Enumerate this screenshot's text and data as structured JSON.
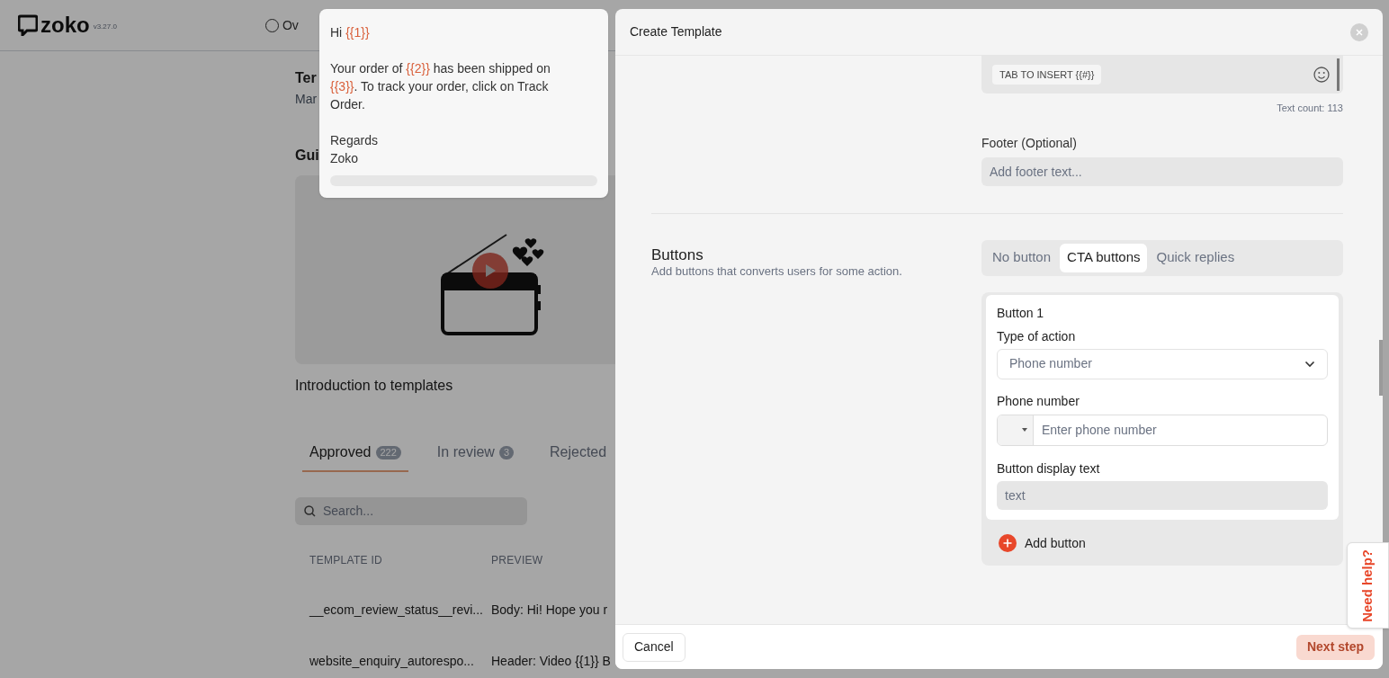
{
  "app": {
    "logo": "zoko",
    "version": "v3.27.0",
    "nav": [
      {
        "label": "Ov"
      }
    ]
  },
  "page": {
    "title": "Ter",
    "subtitle": "Mar",
    "guide_heading": "Gui",
    "video": {
      "caption": "Introduction to templates"
    },
    "tabs": [
      {
        "label": "Approved",
        "count": "222",
        "selected": true
      },
      {
        "label": "In review",
        "count": "3",
        "selected": false
      },
      {
        "label": "Rejected",
        "selected": false
      }
    ],
    "search": {
      "placeholder": "Search..."
    },
    "table": {
      "columns": [
        "TEMPLATE ID",
        "PREVIEW"
      ],
      "rows": [
        [
          "__ecom_review_status__revi...",
          "Body: Hi! Hope you r"
        ],
        [
          "website_enquiry_autorespo...",
          "Header: Video {{1}} B"
        ]
      ]
    }
  },
  "preview_popup": {
    "blocks": [
      {
        "lines": [
          [
            {
              "kind": "text",
              "text": "Hi "
            },
            {
              "kind": "variable",
              "text": "{{1}}"
            }
          ]
        ]
      },
      {
        "lines": [
          [
            {
              "kind": "text",
              "text": "Your order of "
            },
            {
              "kind": "variable",
              "text": "{{2}}"
            },
            {
              "kind": "text",
              "text": " has been shipped on "
            },
            {
              "kind": "variable",
              "text": "{{3}}"
            },
            {
              "kind": "text",
              "text": ". To track your order, click on Track Order."
            }
          ]
        ]
      },
      {
        "lines": [
          [
            {
              "kind": "text",
              "text": "Regards"
            }
          ],
          [
            {
              "kind": "text",
              "text": "Zoko"
            }
          ]
        ]
      }
    ]
  },
  "modal": {
    "title": "Create Template",
    "body_field": {
      "chip": "TAB TO INSERT {{#}}",
      "text_count": "Text count: 113"
    },
    "footer_field": {
      "label": "Footer (Optional)",
      "placeholder": "Add footer text..."
    },
    "buttons_section": {
      "title": "Buttons",
      "description": "Add buttons that converts users for some action.",
      "options": [
        {
          "label": "No button",
          "selected": false
        },
        {
          "label": "CTA buttons",
          "selected": true
        },
        {
          "label": "Quick replies",
          "selected": false
        }
      ],
      "button_cards": [
        {
          "title": "Button 1",
          "action_label": "Type of action",
          "action_value": "Phone number",
          "phone_label": "Phone number",
          "phone_placeholder": "Enter phone number",
          "display_label": "Button display text",
          "display_placeholder": "text"
        }
      ],
      "add_button": "Add button"
    },
    "actions": [
      {
        "label": "Cancel",
        "kind": "secondary",
        "disabled": false
      },
      {
        "label": "Next step",
        "kind": "primary",
        "disabled": true
      }
    ]
  },
  "help_tab": {
    "label": "Need help?"
  }
}
